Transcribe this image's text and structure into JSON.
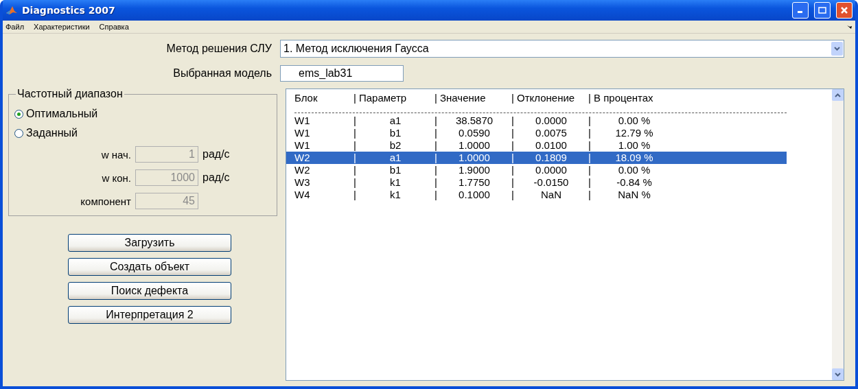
{
  "window": {
    "title": "Diagnostics 2007"
  },
  "menu": [
    "Файл",
    "Характеристики",
    "Справка"
  ],
  "method": {
    "label": "Метод решения СЛУ",
    "value": "1. Метод исключения Гаусса"
  },
  "model": {
    "label": "Выбранная модель",
    "value": "ems_lab31"
  },
  "frequency_range": {
    "title": "Частотный диапазон",
    "options": [
      {
        "label": "Оптимальный",
        "selected": true
      },
      {
        "label": "Заданный",
        "selected": false
      }
    ],
    "fields": [
      {
        "label": "w нач.",
        "value": "1",
        "unit": "рад/с",
        "disabled": true
      },
      {
        "label": "w кон.",
        "value": "1000",
        "unit": "рад/с",
        "disabled": true
      },
      {
        "label": "компонент",
        "value": "45",
        "disabled": true
      }
    ]
  },
  "buttons": [
    "Загрузить",
    "Создать объект",
    "Поиск дефекта",
    "Интерпретация 2"
  ],
  "results": {
    "header": [
      "Блок",
      "|",
      "Параметр",
      "|",
      "Значение",
      "|",
      "Отклонение",
      "|",
      "В процентах"
    ],
    "rows": [
      {
        "cells": [
          "W1",
          "|",
          "a1",
          "|",
          "38.5870",
          "|",
          "0.0000",
          "|",
          "0.00 %"
        ],
        "selected": false
      },
      {
        "cells": [
          "W1",
          "|",
          "b1",
          "|",
          "0.0590",
          "|",
          "0.0075",
          "|",
          "12.79 %"
        ],
        "selected": false
      },
      {
        "cells": [
          "W1",
          "|",
          "b2",
          "|",
          "1.0000",
          "|",
          "0.0100",
          "|",
          "1.00 %"
        ],
        "selected": false
      },
      {
        "cells": [
          "W2",
          "|",
          "a1",
          "|",
          "1.0000",
          "|",
          "0.1809",
          "|",
          "18.09 %"
        ],
        "selected": true
      },
      {
        "cells": [
          "W2",
          "|",
          "b1",
          "|",
          "1.9000",
          "|",
          "0.0000",
          "|",
          "0.00 %"
        ],
        "selected": false
      },
      {
        "cells": [
          "W3",
          "|",
          "k1",
          "|",
          "1.7750",
          "|",
          "-0.0150",
          "|",
          "-0.84 %"
        ],
        "selected": false
      },
      {
        "cells": [
          "W4",
          "|",
          "k1",
          "|",
          "0.1000",
          "|",
          "NaN",
          "|",
          "NaN %"
        ],
        "selected": false
      }
    ]
  }
}
